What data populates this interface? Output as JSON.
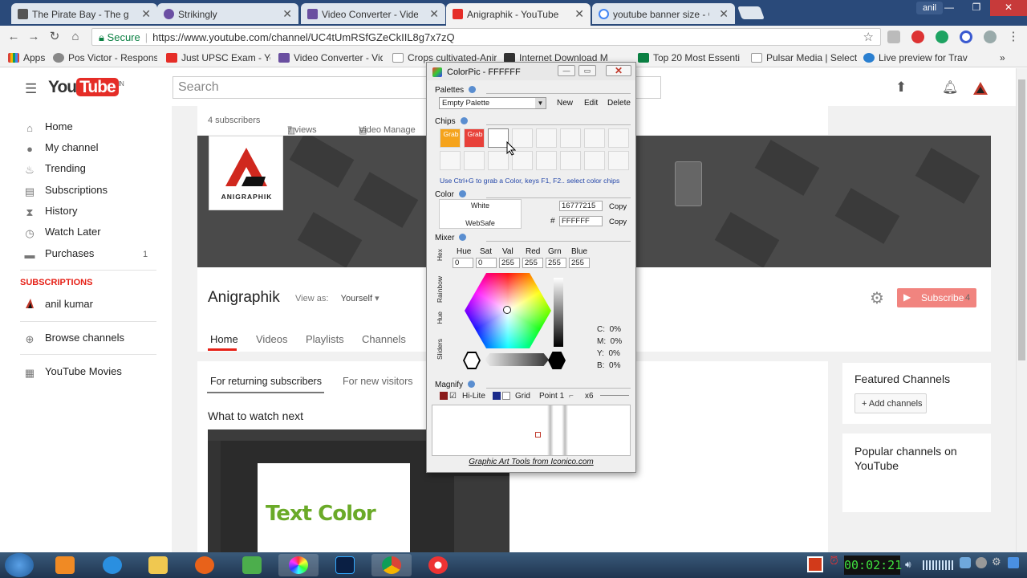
{
  "browser": {
    "tabs": [
      {
        "title": "The Pirate Bay - The gal",
        "color": "#555555"
      },
      {
        "title": "Strikingly",
        "color": "#6b4fa3"
      },
      {
        "title": "Video Converter - Video",
        "color": "#6a4fa0"
      },
      {
        "title": "Anigraphik - YouTube",
        "color": "#e52d27"
      },
      {
        "title": "youtube banner size - Go",
        "color": "#4285f4"
      }
    ],
    "user": "anil",
    "secure_label": "Secure",
    "url": "https://www.youtube.com/channel/UC4tUmRSfGZeCkIIL8g7x7zQ",
    "bookmarks": [
      {
        "label": "Apps",
        "color": "#4285f4"
      },
      {
        "label": "Pos Victor - Respons",
        "color": "#888888"
      },
      {
        "label": "Just UPSC Exam - You",
        "color": "#e52d27"
      },
      {
        "label": "Video Converter - Vid",
        "color": "#6a4fa0"
      },
      {
        "label": "Crops cultivated-Anir",
        "color": "#999999"
      },
      {
        "label": "Internet Download M",
        "color": "#333333"
      },
      {
        "label": "Top 20 Most Essenti",
        "color": "#0b8043"
      },
      {
        "label": "Pulsar Media | Selecte",
        "color": "#999999"
      },
      {
        "label": "Live preview for Trave",
        "color": "#2a7fd0"
      }
    ],
    "more": "»"
  },
  "youtube": {
    "logo_you": "You",
    "logo_tube": "Tube",
    "logo_region": "IN",
    "search_placeholder": "Search",
    "sidebar": [
      {
        "label": "Home",
        "icon": "⌂"
      },
      {
        "label": "My channel",
        "icon": "●"
      },
      {
        "label": "Trending",
        "icon": "♨"
      },
      {
        "label": "Subscriptions",
        "icon": "▤"
      },
      {
        "label": "History",
        "icon": "⧗"
      },
      {
        "label": "Watch Later",
        "icon": "◷"
      },
      {
        "label": "Purchases",
        "icon": "▬",
        "count": "1"
      }
    ],
    "subscriptions_heading": "SUBSCRIPTIONS",
    "subscription_user": "anil kumar",
    "browse_channels": "Browse channels",
    "youtube_movies": "YouTube Movies",
    "stats": {
      "subscribers": "4 subscribers",
      "views": "7 views",
      "video_manager": "Video Manage"
    },
    "avatar_name": "ANIGRAPHIK",
    "channel_name": "Anigraphik",
    "view_as_label": "View as:",
    "view_as_value": "Yourself",
    "subscribe": "Subscribe",
    "subscriber_count": "4",
    "channel_tabs": [
      "Home",
      "Videos",
      "Playlists",
      "Channels"
    ],
    "feed_tabs": [
      "For returning subscribers",
      "For new visitors"
    ],
    "what_to_watch": "What to watch next",
    "video_text": "Text Color",
    "featured_title": "Featured Channels",
    "add_channels": "+ Add channels",
    "popular_title": "Popular channels on YouTube"
  },
  "colorpic": {
    "title": "ColorPic - FFFFFF",
    "palettes_label": "Palettes",
    "palette_selected": "Empty Palette",
    "btn_new": "New",
    "btn_edit": "Edit",
    "btn_delete": "Delete",
    "chips_label": "Chips",
    "chips": [
      {
        "label": "Grab",
        "color": "#f5a31c"
      },
      {
        "label": "Grab",
        "color": "#e8413a"
      }
    ],
    "chip_hint": "Use Ctrl+G to grab a Color, keys F1, F2.. select color chips",
    "color_label": "Color",
    "color_name": "White",
    "websafe": "WebSafe",
    "decimal_value": "16777215",
    "hex_value": "FFFFFF",
    "hash": "#",
    "copy": "Copy",
    "mixer_label": "Mixer",
    "side_tabs": [
      "Hex",
      "Rainbow",
      "Hue",
      "Sliders"
    ],
    "mixer_headers": [
      "Hue",
      "Sat",
      "Val",
      "Red",
      "Grn",
      "Blue"
    ],
    "mixer_values": [
      "0",
      "0",
      "255",
      "255",
      "255",
      "255"
    ],
    "cmyk": [
      {
        "k": "C:",
        "v": "0%"
      },
      {
        "k": "M:",
        "v": "0%"
      },
      {
        "k": "Y:",
        "v": "0%"
      },
      {
        "k": "B:",
        "v": "0%"
      }
    ],
    "magnify_label": "Magnify",
    "hilite": "Hi-Lite",
    "grid": "Grid",
    "point": "Point 1",
    "zoom": "x6",
    "footer": "Graphic Art Tools from Iconico.com"
  },
  "taskbar": {
    "clock": "00:02:21"
  }
}
